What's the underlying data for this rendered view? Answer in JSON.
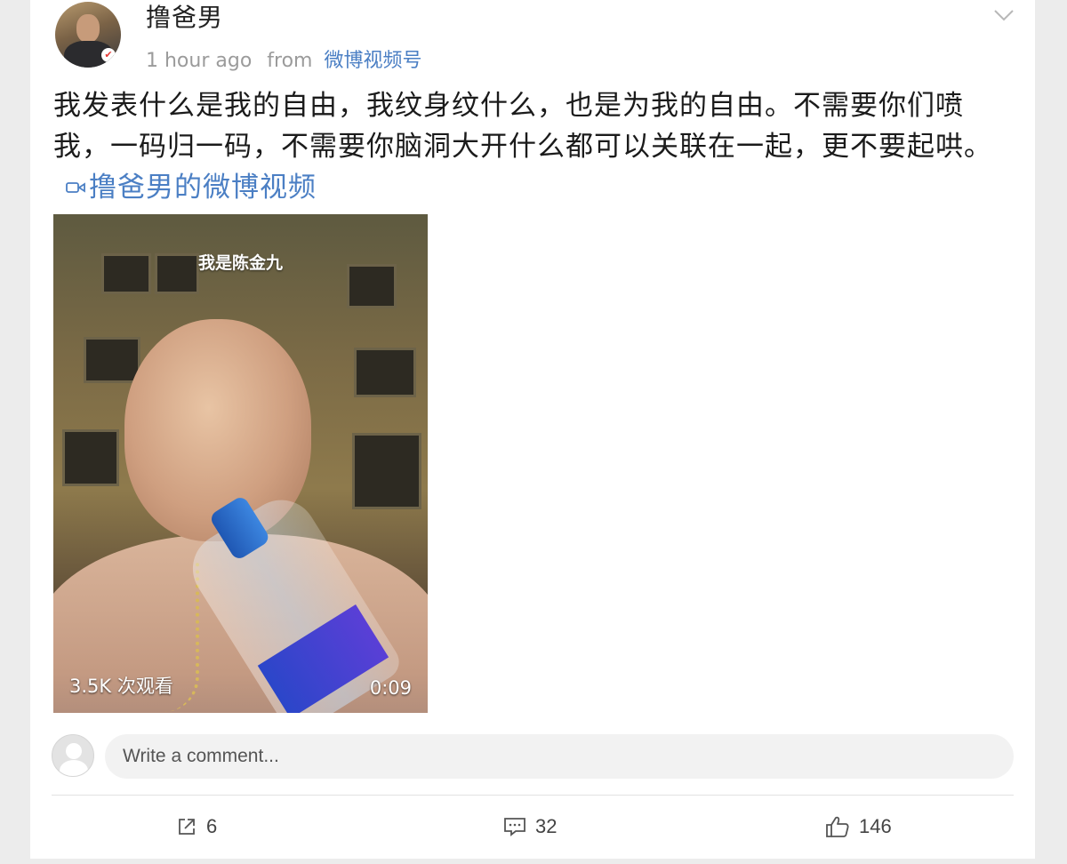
{
  "post": {
    "username": "撸爸男",
    "time": "1 hour ago",
    "from_label": "from",
    "source": "微博视频号",
    "text": "我发表什么是我的自由，我纹身纹什么，也是为我的自由。不需要你们喷我，一码归一码，不需要你脑洞大开什么都可以关联在一起，更不要起哄。",
    "video_link_label": "撸爸男的微博视频"
  },
  "video": {
    "caption": "我是陈金九",
    "views": "3.5K 次观看",
    "duration": "0:09"
  },
  "comment": {
    "placeholder": "Write a comment..."
  },
  "actions": {
    "repost_count": "6",
    "comment_count": "32",
    "like_count": "146"
  },
  "colors": {
    "link": "#4b7fc4",
    "meta": "#9b9b9b",
    "background": "#ececec"
  },
  "icons": {
    "menu": "chevron-down-icon",
    "video_link": "video-camera-icon",
    "repost": "repost-icon",
    "comment": "comment-icon",
    "like": "thumbs-up-icon"
  }
}
